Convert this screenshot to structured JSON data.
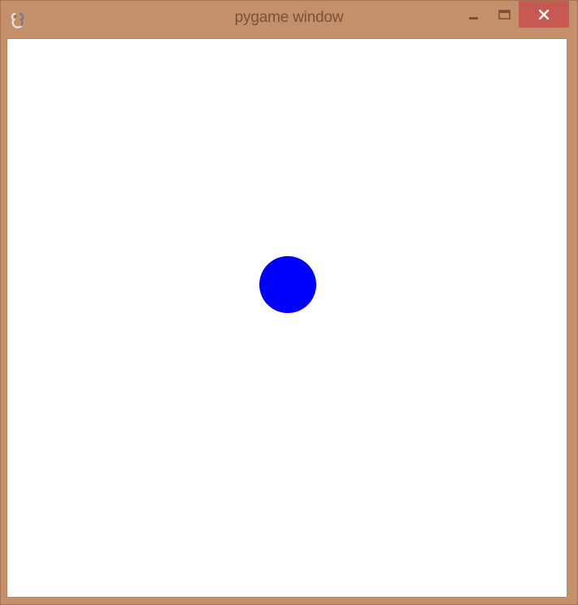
{
  "window": {
    "title": "pygame window",
    "frame_color": "#c4906c",
    "close_button_color": "#c65a52",
    "icons": {
      "app": "pygame-snake-icon",
      "minimize": "minimize-icon",
      "maximize": "maximize-icon",
      "close": "close-icon"
    }
  },
  "game": {
    "background_color": "#ffffff",
    "ball": {
      "color": "#0000ff"
    }
  }
}
